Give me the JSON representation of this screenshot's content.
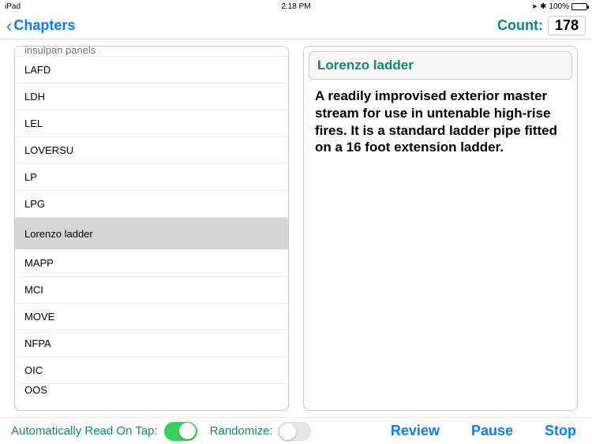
{
  "status": {
    "device": "iPad",
    "time": "2:18 PM",
    "location_icon": "➤",
    "bluetooth_icon": "✱",
    "battery_pct": "100%"
  },
  "nav": {
    "back_label": "Chapters",
    "count_label": "Count:",
    "count_value": "178"
  },
  "list": {
    "items": [
      "insulpan panels",
      "LAFD",
      "LDH",
      "LEL",
      "LOVERSU",
      "LP",
      "LPG",
      "Lorenzo ladder",
      "MAPP",
      "MCI",
      "MOVE",
      "NFPA",
      "OIC",
      "OOS"
    ],
    "selected_index": 7
  },
  "detail": {
    "term": "Lorenzo ladder",
    "definition": "A readily improvised exterior master stream for use in untenable high-rise fires. It is a standard ladder pipe fitted on a 16 foot extension ladder."
  },
  "toolbar": {
    "auto_read_label": "Automatically Read On Tap:",
    "auto_read_on": true,
    "randomize_label": "Randomize:",
    "randomize_on": false,
    "review": "Review",
    "pause": "Pause",
    "stop": "Stop"
  }
}
